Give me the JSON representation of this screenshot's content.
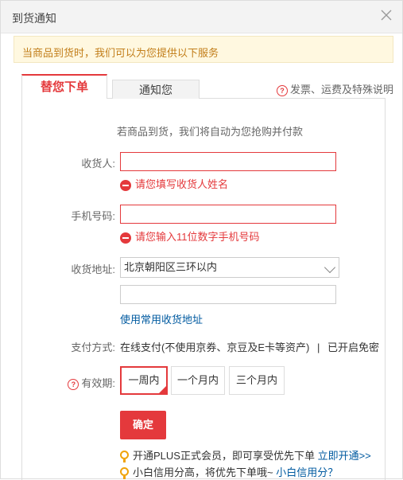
{
  "dialog": {
    "title": "到货通知"
  },
  "notice": {
    "text": "当商品到货时，我们可以为您提供以下服务"
  },
  "tabs": [
    {
      "label": "替您下单",
      "active": true
    },
    {
      "label": "通知您",
      "active": false
    }
  ],
  "help": {
    "icon": "question-circle-icon",
    "label": "发票、运费及特殊说明"
  },
  "form": {
    "intro": "若商品到货，我们将自动为您抢购并付款",
    "receiver": {
      "label": "收货人:",
      "value": "",
      "error": "请您填写收货人姓名"
    },
    "phone": {
      "label": "手机号码:",
      "value": "",
      "error": "请您输入11位数字手机号码"
    },
    "address": {
      "label": "收货地址:",
      "region": "北京朝阳区三环以内",
      "detail": "",
      "common_link": "使用常用收货地址"
    },
    "payment": {
      "label": "支付方式:",
      "value": "在线支付(不使用京券、京豆及E卡等资产)",
      "divider": "|",
      "status": "已开启免密"
    },
    "validity": {
      "label": "有效期:",
      "options": [
        "一周内",
        "一个月内",
        "三个月内"
      ],
      "selected": "一周内"
    },
    "confirm_label": "确定"
  },
  "tips": [
    {
      "text": "开通PLUS正式会员，即可享受优先下单",
      "link": "立即开通>>"
    },
    {
      "text": "小白信用分高，将优先下单哦~",
      "link": "小白信用分？"
    }
  ],
  "colors": {
    "accent": "#e4393c",
    "link": "#005aa0",
    "notice_text": "#c27e1a",
    "notice_bg": "#fff8e0"
  }
}
